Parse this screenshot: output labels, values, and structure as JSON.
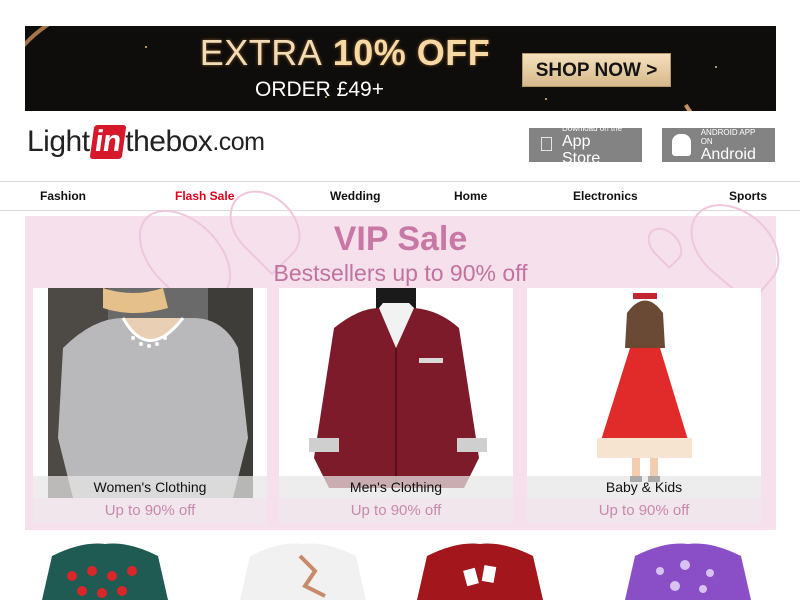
{
  "promo": {
    "headline_pre": "EXTRA",
    "headline_main": "10% OFF",
    "subline": "ORDER £49+",
    "cta": "SHOP NOW >"
  },
  "logo": {
    "left": "Light",
    "middle": "in",
    "right": "thebox",
    "tld": ".com"
  },
  "stores": {
    "appstore_small": "Download on the",
    "appstore_big": "App Store",
    "android_small": "ANDROID APP ON",
    "android_big": "Android"
  },
  "nav": [
    "Fashion",
    "Flash Sale",
    "Wedding",
    "Home",
    "Electronics",
    "Sports"
  ],
  "vip": {
    "title": "VIP Sale",
    "subtitle": "Bestsellers up to 90% off",
    "cards": [
      {
        "label": "Women's Clothing",
        "discount": "Up to 90% off"
      },
      {
        "label": "Men's Clothing",
        "discount": "Up to 90% off"
      },
      {
        "label": "Baby & Kids",
        "discount": "Up to 90% off"
      }
    ]
  },
  "colors": {
    "sale_red": "#e4001b",
    "vip_bg": "#f5e0ec",
    "vip_text": "#c978a6",
    "nav_border": "#d8d8d8"
  }
}
